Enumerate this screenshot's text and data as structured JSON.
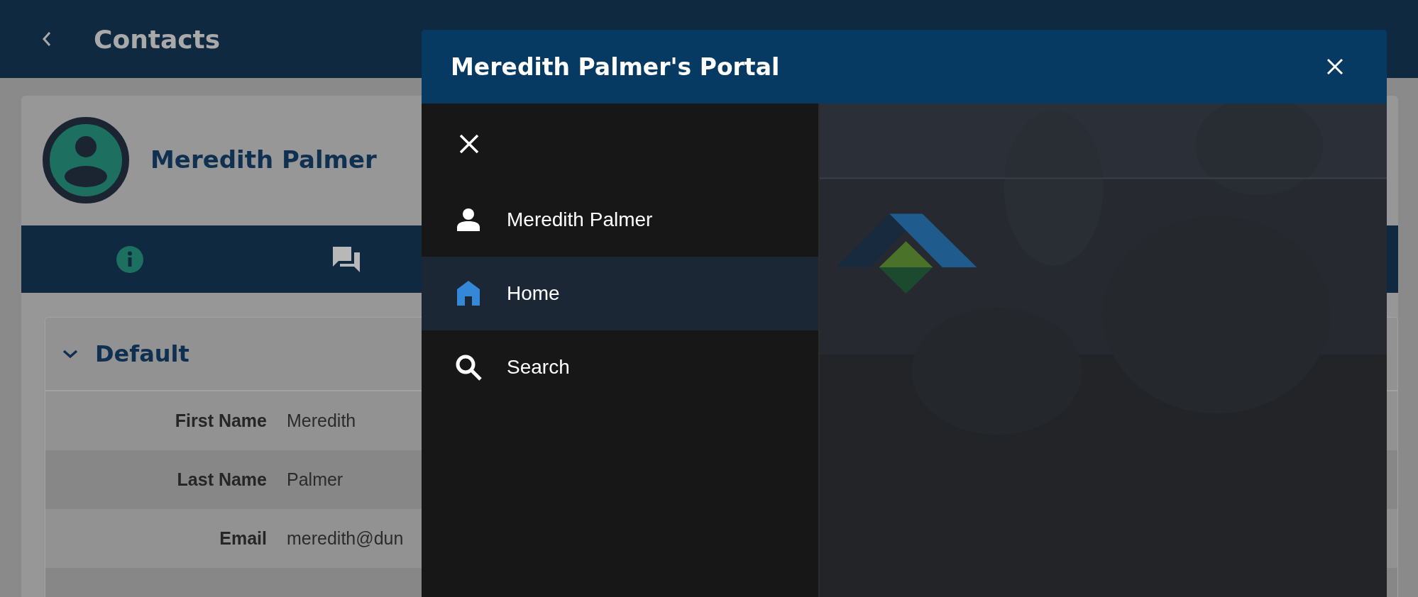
{
  "app_bar": {
    "title": "Contacts"
  },
  "contact": {
    "name": "Meredith Palmer"
  },
  "tabs": [
    {
      "kind": "info",
      "selected": true
    },
    {
      "kind": "chat",
      "selected": false
    }
  ],
  "section": {
    "title": "Default",
    "expanded": true,
    "fields": [
      {
        "label": "First Name",
        "value": "Meredith"
      },
      {
        "label": "Last Name",
        "value": "Palmer"
      },
      {
        "label": "Email",
        "value": "meredith@dun"
      }
    ]
  },
  "portal": {
    "title": "Meredith Palmer's Portal",
    "menu": [
      {
        "kind": "person",
        "label": "Meredith Palmer",
        "selected": false
      },
      {
        "kind": "home",
        "label": "Home",
        "selected": true
      },
      {
        "kind": "search",
        "label": "Search",
        "selected": false
      }
    ]
  }
}
